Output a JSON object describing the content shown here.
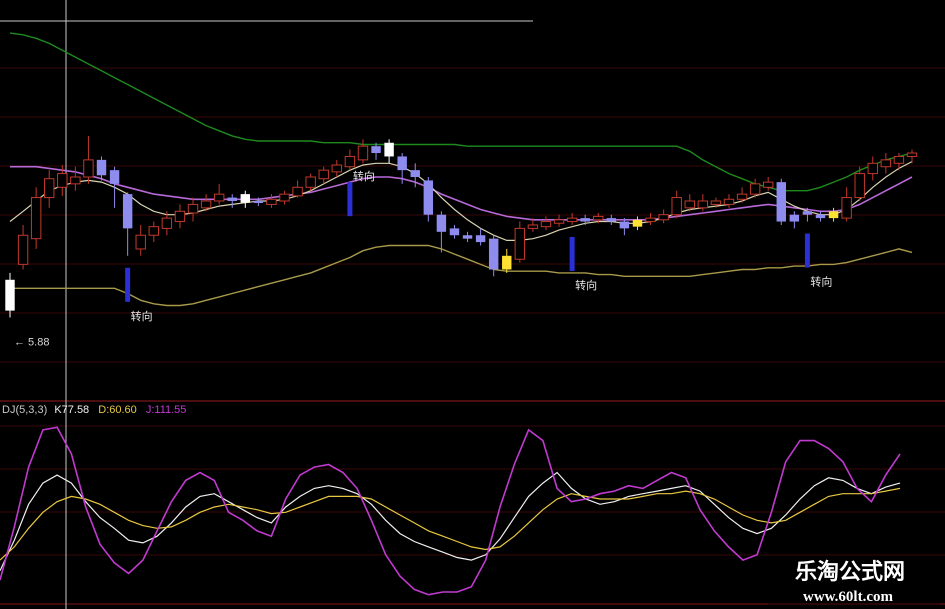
{
  "chart_data": [
    {
      "type": "candlestick",
      "panel": "price",
      "price_label": "5.88",
      "signal_label": "转向",
      "colors": {
        "up": "#c0392b",
        "down": "#8f8cf0",
        "highlight_up": "#ffffff",
        "highlight_down": "#ffe033",
        "signal": "#2a2fd6",
        "envelope_upper": "#1e8a1e",
        "envelope_lower": "#a89a4a",
        "ma_fast": "#d9d4b0",
        "ma_slow": "#b86ad8"
      },
      "candles": [
        {
          "o": 5.78,
          "c": 5.96,
          "h": 6.0,
          "l": 5.74,
          "t": "hl_up"
        },
        {
          "o": 6.05,
          "c": 6.22,
          "h": 6.28,
          "l": 6.02,
          "t": "up"
        },
        {
          "o": 6.2,
          "c": 6.44,
          "h": 6.5,
          "l": 6.14,
          "t": "up"
        },
        {
          "o": 6.44,
          "c": 6.55,
          "h": 6.6,
          "l": 6.38,
          "t": "up"
        },
        {
          "o": 6.5,
          "c": 6.58,
          "h": 6.63,
          "l": 6.45,
          "t": "up"
        },
        {
          "o": 6.52,
          "c": 6.56,
          "h": 6.62,
          "l": 6.48,
          "t": "up"
        },
        {
          "o": 6.56,
          "c": 6.66,
          "h": 6.8,
          "l": 6.52,
          "t": "up"
        },
        {
          "o": 6.66,
          "c": 6.57,
          "h": 6.68,
          "l": 6.54,
          "t": "down"
        },
        {
          "o": 6.6,
          "c": 6.52,
          "h": 6.62,
          "l": 6.38,
          "t": "down"
        },
        {
          "o": 6.46,
          "c": 6.26,
          "h": 6.47,
          "l": 6.1,
          "t": "down"
        },
        {
          "o": 6.14,
          "c": 6.22,
          "h": 6.28,
          "l": 6.1,
          "t": "up"
        },
        {
          "o": 6.22,
          "c": 6.27,
          "h": 6.3,
          "l": 6.18,
          "t": "up"
        },
        {
          "o": 6.26,
          "c": 6.32,
          "h": 6.36,
          "l": 6.22,
          "t": "up"
        },
        {
          "o": 6.3,
          "c": 6.36,
          "h": 6.4,
          "l": 6.26,
          "t": "up"
        },
        {
          "o": 6.35,
          "c": 6.4,
          "h": 6.44,
          "l": 6.3,
          "t": "up"
        },
        {
          "o": 6.38,
          "c": 6.42,
          "h": 6.46,
          "l": 6.36,
          "t": "up"
        },
        {
          "o": 6.42,
          "c": 6.46,
          "h": 6.52,
          "l": 6.4,
          "t": "up"
        },
        {
          "o": 6.44,
          "c": 6.42,
          "h": 6.46,
          "l": 6.38,
          "t": "down"
        },
        {
          "o": 6.46,
          "c": 6.41,
          "h": 6.48,
          "l": 6.38,
          "t": "hl_up"
        },
        {
          "o": 6.41,
          "c": 6.42,
          "h": 6.44,
          "l": 6.39,
          "t": "down"
        },
        {
          "o": 6.4,
          "c": 6.43,
          "h": 6.46,
          "l": 6.38,
          "t": "up"
        },
        {
          "o": 6.42,
          "c": 6.46,
          "h": 6.48,
          "l": 6.4,
          "t": "up"
        },
        {
          "o": 6.45,
          "c": 6.5,
          "h": 6.54,
          "l": 6.44,
          "t": "up"
        },
        {
          "o": 6.5,
          "c": 6.56,
          "h": 6.58,
          "l": 6.48,
          "t": "up"
        },
        {
          "o": 6.55,
          "c": 6.6,
          "h": 6.62,
          "l": 6.52,
          "t": "up"
        },
        {
          "o": 6.59,
          "c": 6.63,
          "h": 6.66,
          "l": 6.56,
          "t": "up"
        },
        {
          "o": 6.62,
          "c": 6.68,
          "h": 6.72,
          "l": 6.6,
          "t": "up"
        },
        {
          "o": 6.66,
          "c": 6.74,
          "h": 6.78,
          "l": 6.64,
          "t": "up"
        },
        {
          "o": 6.74,
          "c": 6.7,
          "h": 6.76,
          "l": 6.66,
          "t": "down"
        },
        {
          "o": 6.76,
          "c": 6.68,
          "h": 6.78,
          "l": 6.64,
          "t": "hl_up"
        },
        {
          "o": 6.68,
          "c": 6.6,
          "h": 6.7,
          "l": 6.52,
          "t": "down"
        },
        {
          "o": 6.6,
          "c": 6.56,
          "h": 6.64,
          "l": 6.5,
          "t": "down"
        },
        {
          "o": 6.54,
          "c": 6.34,
          "h": 6.56,
          "l": 6.3,
          "t": "down"
        },
        {
          "o": 6.34,
          "c": 6.24,
          "h": 6.36,
          "l": 6.12,
          "t": "down"
        },
        {
          "o": 6.26,
          "c": 6.22,
          "h": 6.28,
          "l": 6.2,
          "t": "down"
        },
        {
          "o": 6.22,
          "c": 6.2,
          "h": 6.24,
          "l": 6.18,
          "t": "down"
        },
        {
          "o": 6.18,
          "c": 6.22,
          "h": 6.26,
          "l": 6.16,
          "t": "down"
        },
        {
          "o": 6.2,
          "c": 6.02,
          "h": 6.22,
          "l": 5.98,
          "t": "down"
        },
        {
          "o": 6.02,
          "c": 6.1,
          "h": 6.14,
          "l": 6.0,
          "t": "hl_down"
        },
        {
          "o": 6.08,
          "c": 6.26,
          "h": 6.3,
          "l": 6.06,
          "t": "up"
        },
        {
          "o": 6.26,
          "c": 6.28,
          "h": 6.32,
          "l": 6.24,
          "t": "up"
        },
        {
          "o": 6.27,
          "c": 6.3,
          "h": 6.33,
          "l": 6.25,
          "t": "up"
        },
        {
          "o": 6.29,
          "c": 6.31,
          "h": 6.34,
          "l": 6.27,
          "t": "up"
        },
        {
          "o": 6.3,
          "c": 6.32,
          "h": 6.35,
          "l": 6.28,
          "t": "up"
        },
        {
          "o": 6.32,
          "c": 6.3,
          "h": 6.34,
          "l": 6.28,
          "t": "down"
        },
        {
          "o": 6.31,
          "c": 6.33,
          "h": 6.35,
          "l": 6.29,
          "t": "up"
        },
        {
          "o": 6.32,
          "c": 6.3,
          "h": 6.34,
          "l": 6.28,
          "t": "down"
        },
        {
          "o": 6.3,
          "c": 6.26,
          "h": 6.32,
          "l": 6.22,
          "t": "down"
        },
        {
          "o": 6.27,
          "c": 6.31,
          "h": 6.33,
          "l": 6.25,
          "t": "hl_down"
        },
        {
          "o": 6.3,
          "c": 6.32,
          "h": 6.35,
          "l": 6.28,
          "t": "up"
        },
        {
          "o": 6.31,
          "c": 6.34,
          "h": 6.37,
          "l": 6.29,
          "t": "up"
        },
        {
          "o": 6.34,
          "c": 6.44,
          "h": 6.48,
          "l": 6.32,
          "t": "up"
        },
        {
          "o": 6.42,
          "c": 6.38,
          "h": 6.46,
          "l": 6.36,
          "t": "up"
        },
        {
          "o": 6.38,
          "c": 6.42,
          "h": 6.46,
          "l": 6.36,
          "t": "up"
        },
        {
          "o": 6.42,
          "c": 6.4,
          "h": 6.44,
          "l": 6.38,
          "t": "up"
        },
        {
          "o": 6.4,
          "c": 6.43,
          "h": 6.46,
          "l": 6.38,
          "t": "up"
        },
        {
          "o": 6.43,
          "c": 6.46,
          "h": 6.5,
          "l": 6.41,
          "t": "up"
        },
        {
          "o": 6.46,
          "c": 6.52,
          "h": 6.55,
          "l": 6.44,
          "t": "up"
        },
        {
          "o": 6.5,
          "c": 6.53,
          "h": 6.56,
          "l": 6.48,
          "t": "up"
        },
        {
          "o": 6.53,
          "c": 6.3,
          "h": 6.55,
          "l": 6.28,
          "t": "down"
        },
        {
          "o": 6.3,
          "c": 6.34,
          "h": 6.36,
          "l": 6.26,
          "t": "down"
        },
        {
          "o": 6.34,
          "c": 6.36,
          "h": 6.38,
          "l": 6.3,
          "t": "down"
        },
        {
          "o": 6.34,
          "c": 6.32,
          "h": 6.36,
          "l": 6.3,
          "t": "down"
        },
        {
          "o": 6.32,
          "c": 6.36,
          "h": 6.38,
          "l": 6.3,
          "t": "hl_down"
        },
        {
          "o": 6.32,
          "c": 6.44,
          "h": 6.5,
          "l": 6.3,
          "t": "up"
        },
        {
          "o": 6.44,
          "c": 6.58,
          "h": 6.62,
          "l": 6.42,
          "t": "up"
        },
        {
          "o": 6.58,
          "c": 6.64,
          "h": 6.68,
          "l": 6.54,
          "t": "up"
        },
        {
          "o": 6.62,
          "c": 6.66,
          "h": 6.7,
          "l": 6.58,
          "t": "up"
        },
        {
          "o": 6.64,
          "c": 6.68,
          "h": 6.7,
          "l": 6.6,
          "t": "up"
        },
        {
          "o": 6.68,
          "c": 6.7,
          "h": 6.72,
          "l": 6.64,
          "t": "up"
        }
      ],
      "envelope_upper": [
        7.4,
        7.39,
        7.37,
        7.34,
        7.3,
        7.26,
        7.22,
        7.18,
        7.14,
        7.1,
        7.06,
        7.02,
        6.98,
        6.94,
        6.9,
        6.86,
        6.83,
        6.8,
        6.78,
        6.77,
        6.77,
        6.77,
        6.77,
        6.77,
        6.76,
        6.76,
        6.76,
        6.75,
        6.75,
        6.75,
        6.75,
        6.75,
        6.75,
        6.75,
        6.75,
        6.74,
        6.74,
        6.74,
        6.74,
        6.74,
        6.74,
        6.74,
        6.74,
        6.74,
        6.74,
        6.74,
        6.74,
        6.74,
        6.74,
        6.74,
        6.74,
        6.74,
        6.71,
        6.66,
        6.62,
        6.58,
        6.55,
        6.52,
        6.5,
        6.48,
        6.48,
        6.48,
        6.5,
        6.53,
        6.56,
        6.6,
        6.63,
        6.66,
        6.68,
        6.7
      ],
      "envelope_lower": [
        5.91,
        5.91,
        5.91,
        5.91,
        5.91,
        5.91,
        5.91,
        5.91,
        5.91,
        5.88,
        5.84,
        5.82,
        5.81,
        5.81,
        5.82,
        5.84,
        5.86,
        5.88,
        5.9,
        5.92,
        5.94,
        5.96,
        5.98,
        6.0,
        6.03,
        6.06,
        6.09,
        6.13,
        6.15,
        6.16,
        6.16,
        6.16,
        6.16,
        6.14,
        6.11,
        6.08,
        6.05,
        6.02,
        6.01,
        6.01,
        6.01,
        6.01,
        6.0,
        6.0,
        6.0,
        5.99,
        5.99,
        5.98,
        5.98,
        5.98,
        5.98,
        5.98,
        5.98,
        5.99,
        6.0,
        6.01,
        6.02,
        6.02,
        6.03,
        6.03,
        6.04,
        6.04,
        6.05,
        6.05,
        6.06,
        6.08,
        6.1,
        6.12,
        6.14,
        6.12
      ],
      "ma_fast": [
        6.3,
        6.36,
        6.42,
        6.48,
        6.51,
        6.53,
        6.54,
        6.53,
        6.5,
        6.46,
        6.4,
        6.36,
        6.34,
        6.34,
        6.35,
        6.37,
        6.39,
        6.4,
        6.41,
        6.42,
        6.42,
        6.43,
        6.45,
        6.48,
        6.52,
        6.56,
        6.6,
        6.63,
        6.64,
        6.64,
        6.62,
        6.58,
        6.52,
        6.44,
        6.37,
        6.31,
        6.26,
        6.22,
        6.19,
        6.19,
        6.2,
        6.22,
        6.25,
        6.27,
        6.29,
        6.3,
        6.3,
        6.29,
        6.29,
        6.3,
        6.32,
        6.35,
        6.37,
        6.38,
        6.39,
        6.4,
        6.42,
        6.45,
        6.47,
        6.43,
        6.39,
        6.36,
        6.34,
        6.34,
        6.37,
        6.43,
        6.5,
        6.56,
        6.61,
        6.65
      ],
      "ma_slow": [
        6.62,
        6.62,
        6.62,
        6.61,
        6.6,
        6.59,
        6.57,
        6.55,
        6.52,
        6.5,
        6.48,
        6.46,
        6.45,
        6.44,
        6.43,
        6.43,
        6.43,
        6.43,
        6.43,
        6.43,
        6.44,
        6.45,
        6.46,
        6.47,
        6.49,
        6.51,
        6.53,
        6.55,
        6.56,
        6.56,
        6.55,
        6.53,
        6.5,
        6.46,
        6.43,
        6.4,
        6.37,
        6.35,
        6.33,
        6.32,
        6.31,
        6.31,
        6.31,
        6.31,
        6.31,
        6.31,
        6.31,
        6.31,
        6.31,
        6.31,
        6.32,
        6.33,
        6.34,
        6.35,
        6.36,
        6.37,
        6.38,
        6.39,
        6.4,
        6.39,
        6.38,
        6.37,
        6.36,
        6.36,
        6.37,
        6.4,
        6.44,
        6.48,
        6.52,
        6.56
      ],
      "signals": [
        {
          "index": 9,
          "label": "转向",
          "label_side": "below"
        },
        {
          "index": 26,
          "label": "转向",
          "label_side": "above"
        },
        {
          "index": 43,
          "label": "转向",
          "label_side": "below"
        },
        {
          "index": 61,
          "label": "转向",
          "label_side": "below"
        }
      ],
      "ylim": [
        5.55,
        7.5
      ]
    },
    {
      "type": "line",
      "panel": "indicator",
      "legend": {
        "name": "DJ(5,3,3)",
        "k": "K77.58",
        "d": "D:60.60",
        "j": "J:111.55"
      },
      "colors": {
        "k": "#f0f0f0",
        "d": "#e8c840",
        "j": "#c13ad0",
        "legend_name": "#c8c8c8"
      },
      "ylim": [
        -10,
        130
      ],
      "series": [
        {
          "key": "k",
          "values": [
            12,
            35,
            62,
            78,
            84,
            78,
            64,
            52,
            44,
            35,
            33,
            38,
            48,
            60,
            68,
            70,
            64,
            58,
            52,
            48,
            60,
            68,
            74,
            76,
            74,
            70,
            62,
            50,
            40,
            34,
            30,
            26,
            22,
            20,
            24,
            36,
            52,
            68,
            78,
            86,
            74,
            66,
            62,
            64,
            68,
            70,
            72,
            74,
            76,
            72,
            62,
            52,
            44,
            40,
            44,
            54,
            66,
            76,
            82,
            80,
            74,
            70,
            75,
            78
          ]
        },
        {
          "key": "d",
          "values": [
            20,
            30,
            44,
            56,
            64,
            68,
            66,
            62,
            56,
            50,
            46,
            44,
            45,
            50,
            56,
            60,
            62,
            60,
            58,
            55,
            56,
            60,
            64,
            68,
            68,
            68,
            66,
            60,
            54,
            48,
            42,
            38,
            34,
            30,
            28,
            30,
            38,
            48,
            58,
            66,
            70,
            68,
            66,
            66,
            66,
            68,
            70,
            70,
            72,
            70,
            66,
            60,
            54,
            50,
            48,
            50,
            56,
            62,
            68,
            70,
            70,
            70,
            72,
            74
          ]
        },
        {
          "key": "j",
          "values": [
            5,
            45,
            90,
            118,
            120,
            100,
            60,
            32,
            18,
            10,
            20,
            42,
            64,
            80,
            86,
            80,
            56,
            50,
            42,
            38,
            66,
            84,
            90,
            92,
            86,
            74,
            50,
            24,
            8,
            -2,
            -6,
            -4,
            -4,
            0,
            20,
            60,
            92,
            118,
            110,
            74,
            64,
            66,
            70,
            72,
            76,
            74,
            80,
            86,
            82,
            58,
            42,
            30,
            20,
            24,
            56,
            94,
            110,
            110,
            104,
            94,
            74,
            64,
            84,
            100
          ]
        }
      ]
    }
  ],
  "watermark": {
    "title": "乐淘公式网",
    "url": "www.60lt.com"
  }
}
